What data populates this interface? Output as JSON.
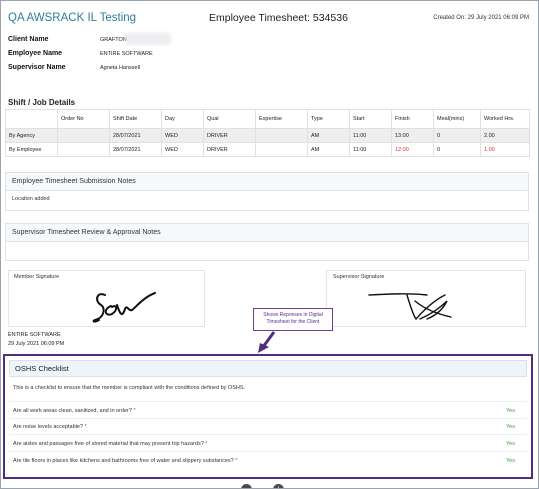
{
  "header": {
    "app_title": "QA AWSRACK IL Testing",
    "doc_title": "Employee Timesheet: 534536",
    "created": "Created On: 29 July 2021 06:09 PM"
  },
  "info": {
    "client_label": "Client Name",
    "client_value": "GRAFTON",
    "employee_label": "Employee Name",
    "employee_value": "ENTIRE SOFTWARE",
    "supervisor_label": "Supervisor Name",
    "supervisor_value": "Agneta Hanssell"
  },
  "shift": {
    "title": "Shift / Job Details",
    "columns": [
      "",
      "Order No",
      "Shift Date",
      "Day",
      "Qual",
      "Expertise",
      "Type",
      "Start",
      "Finish",
      "Meal(mins)",
      "Worked Hrs."
    ],
    "rows": [
      [
        "By Agency",
        "",
        "28/07/2021",
        "WED",
        "DRIVER",
        "",
        "AM",
        "11:00",
        "13:00",
        "0",
        "2.00"
      ],
      [
        "By Employee",
        "",
        "28/07/2021",
        "WED",
        "DRIVER",
        "",
        "AM",
        "11:00",
        "12:00",
        "0",
        "1.00"
      ]
    ]
  },
  "submission_notes": {
    "title": "Employee Timesheet Submission Notes",
    "body": "Location added"
  },
  "supervisor_notes": {
    "title": "Supervisor Timesheet Review & Approval Notes"
  },
  "signatures": {
    "member_label": "Member Signature",
    "supervisor_label": "Supervisor Signature",
    "member_name": "ENTIRE SOFTWARE",
    "member_date": "29 July 2021 06:09 PM"
  },
  "callout": {
    "line1": "Shows Reponses in Digital",
    "line2": "Timesheet for the Client"
  },
  "osh": {
    "title": "OSHS Checklist",
    "description": "This is a checklist to ensure that the member is compliant with the conditions defined by OSHS.",
    "items": [
      {
        "q": "Are all work areas clean, sanitized, and in order?",
        "a": "Yes"
      },
      {
        "q": "Are noise levels acceptable?",
        "a": "Yes"
      },
      {
        "q": "Are aisles and passages free of stored material that may present trip hazards?",
        "a": "Yes"
      },
      {
        "q": "Are tile floors in places like kitchens and bathrooms free of water and slippery substances?",
        "a": "Yes"
      }
    ]
  },
  "zoom": {
    "minus": "−",
    "plus": "+"
  },
  "colors": {
    "title_teal": "#2e7d98",
    "callout_purple": "#4f2d7f",
    "red": "#d1342c",
    "yes_green": "#3a9a35"
  }
}
